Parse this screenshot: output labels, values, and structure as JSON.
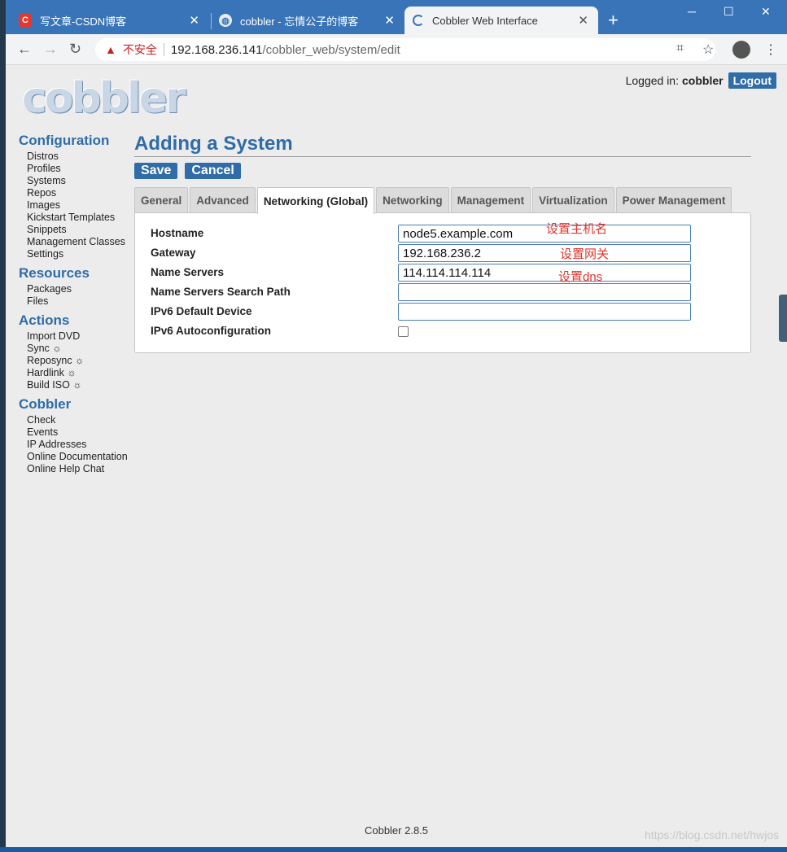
{
  "browser": {
    "tabs": [
      {
        "title": "写文章-CSDN博客",
        "icon": "csdn-icon",
        "icon_color": "#e7372c"
      },
      {
        "title": "cobbler - 忘情公子的博客",
        "icon": "globe-icon"
      },
      {
        "title": "Cobbler Web Interface",
        "icon": "loading-icon"
      }
    ],
    "address": {
      "insecure_label": "不安全",
      "host": "192.168.236.141",
      "path": "/cobbler_web/system/edit"
    }
  },
  "header": {
    "logo_text": "cobbler",
    "logged_in_label": "Logged in:",
    "username": "cobbler",
    "logout_label": "Logout"
  },
  "sidebar": {
    "sections": [
      {
        "title": "Configuration",
        "items": [
          "Distros",
          "Profiles",
          "Systems",
          "Repos",
          "Images",
          "Kickstart Templates",
          "Snippets",
          "Management Classes",
          "Settings"
        ]
      },
      {
        "title": "Resources",
        "items": [
          "Packages",
          "Files"
        ]
      },
      {
        "title": "Actions",
        "items": [
          "Import DVD",
          "Sync ☼",
          "Reposync ☼",
          "Hardlink ☼",
          "Build ISO ☼"
        ]
      },
      {
        "title": "Cobbler",
        "items": [
          "Check",
          "Events",
          "IP Addresses",
          "Online Documentation",
          "Online Help Chat"
        ]
      }
    ]
  },
  "main": {
    "title": "Adding a System",
    "save_label": "Save",
    "cancel_label": "Cancel",
    "tabs": [
      "General",
      "Advanced",
      "Networking (Global)",
      "Networking",
      "Management",
      "Virtualization",
      "Power Management"
    ],
    "selected_tab": "Networking (Global)",
    "fields": [
      {
        "label": "Hostname",
        "value": "node5.example.com",
        "type": "text"
      },
      {
        "label": "Gateway",
        "value": "192.168.236.2",
        "type": "text"
      },
      {
        "label": "Name Servers",
        "value": "114.114.114.114",
        "type": "text"
      },
      {
        "label": "Name Servers Search Path",
        "value": "",
        "type": "text"
      },
      {
        "label": "IPv6 Default Device",
        "value": "",
        "type": "text"
      },
      {
        "label": "IPv6 Autoconfiguration",
        "checked": false,
        "type": "checkbox"
      }
    ],
    "annotations": [
      "设置主机名",
      "设置网关",
      "设置dns"
    ]
  },
  "footer": {
    "version": "Cobbler 2.8.5"
  },
  "watermark": "https://blog.csdn.net/hwjos",
  "colors": {
    "accent": "#2f6ca8",
    "annotation": "#e0342b",
    "tabstrip": "#3974b8"
  }
}
